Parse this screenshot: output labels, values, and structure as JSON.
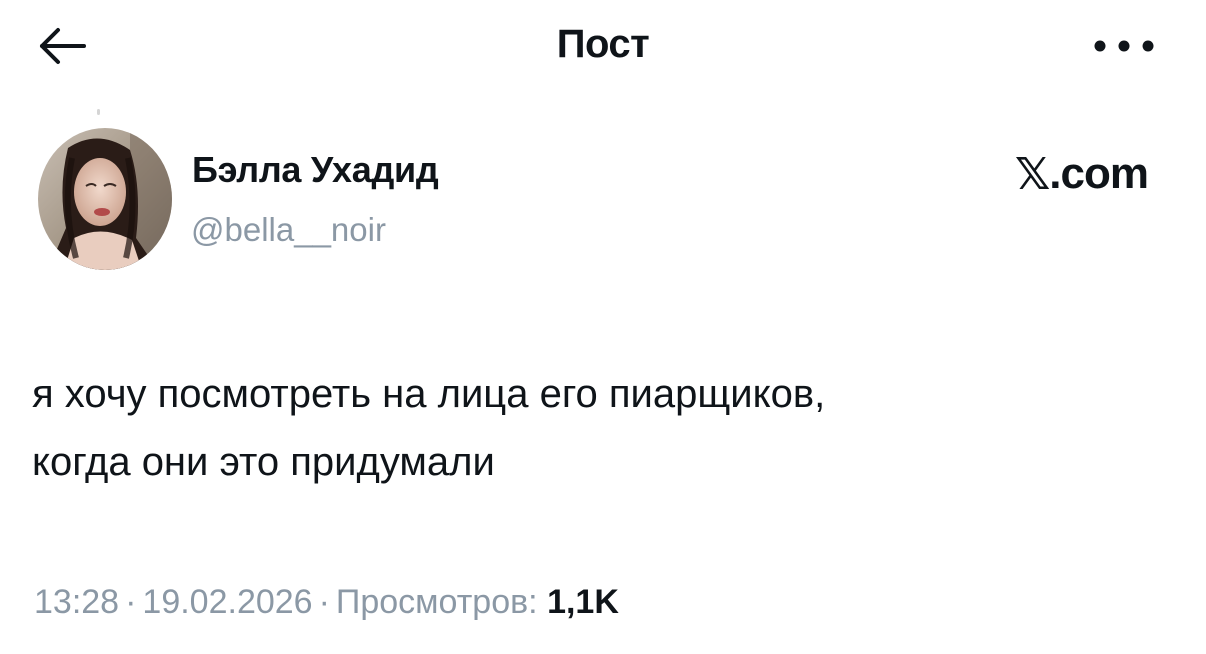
{
  "header": {
    "title": "Пост",
    "back_icon": "arrow-left-icon",
    "more_icon": "more-dots-icon"
  },
  "author": {
    "name": "Бэлла Ухадид",
    "handle": "@bella__noir"
  },
  "brand": {
    "label": "X.com",
    "x_glyph": "𝕏",
    "suffix": ".com"
  },
  "post": {
    "text": "я хочу посмотреть на лица его пиарщиков,\nкогда они это придумали"
  },
  "meta": {
    "time": "13:28",
    "date": "19.02.2026",
    "separator": "·",
    "views_label": "Просмотров:",
    "views_count": "1,1K"
  },
  "colors": {
    "text_primary": "#0f1419",
    "text_secondary": "#8b98a5",
    "background": "#ffffff"
  }
}
